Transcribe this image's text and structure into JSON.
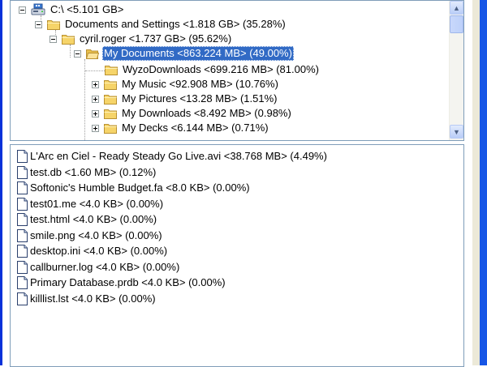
{
  "tree": {
    "items": [
      {
        "label": "C:\\  <5.101 GB>",
        "icon": "drive-icon",
        "expander": "minus"
      },
      {
        "label": "Documents and Settings  <1.818 GB>  (35.28%)",
        "icon": "folder-icon",
        "expander": "minus"
      },
      {
        "label": "cyril.roger  <1.737 GB>  (95.62%)",
        "icon": "folder-icon",
        "expander": "minus"
      },
      {
        "label": "My Documents  <863.224 MB>  (49.00%)",
        "icon": "folder-open-icon",
        "expander": "minus",
        "selected": true
      },
      {
        "label": "WyzoDownloads  <699.216 MB>  (81.00%)",
        "icon": "folder-icon",
        "expander": "none"
      },
      {
        "label": "My Music  <92.908 MB>  (10.76%)",
        "icon": "folder-icon",
        "expander": "plus"
      },
      {
        "label": "My Pictures  <13.28 MB>  (1.51%)",
        "icon": "folder-icon",
        "expander": "plus"
      },
      {
        "label": "My Downloads  <8.492 MB>  (0.98%)",
        "icon": "folder-icon",
        "expander": "plus"
      },
      {
        "label": "My Decks  <6.144 MB>  (0.71%)",
        "icon": "folder-icon",
        "expander": "plus"
      }
    ]
  },
  "files": [
    {
      "label": "L'Arc en Ciel - Ready Steady Go Live.avi  <38.768 MB>  (4.49%)"
    },
    {
      "label": "test.db  <1.60 MB>  (0.12%)"
    },
    {
      "label": "Softonic's Humble Budget.fa  <8.0 KB>  (0.00%)"
    },
    {
      "label": "test01.me  <4.0 KB>  (0.00%)"
    },
    {
      "label": "test.html  <4.0 KB>  (0.00%)"
    },
    {
      "label": "smile.png  <4.0 KB>  (0.00%)"
    },
    {
      "label": "desktop.ini  <4.0 KB>  (0.00%)"
    },
    {
      "label": "callburner.log  <4.0 KB>  (0.00%)"
    },
    {
      "label": "Primary Database.prdb  <4.0 KB>  (0.00%)"
    },
    {
      "label": "killlist.lst  <4.0 KB>  (0.00%)"
    }
  ],
  "colors": {
    "selection": "#316ac5",
    "folder": "#f4d06b",
    "panel_border": "#7f9db9"
  }
}
